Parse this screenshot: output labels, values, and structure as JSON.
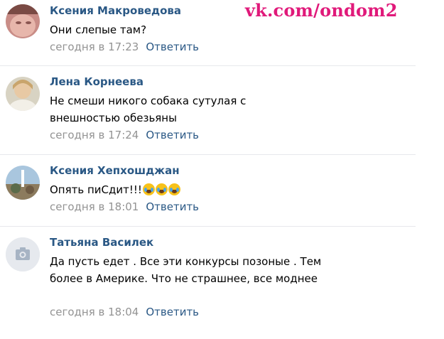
{
  "watermark": "vk.com/ondom2",
  "reply_label": "Ответить",
  "comments": [
    {
      "author": "Ксения Макроведова",
      "text": "Они слепые там?",
      "date": "сегодня в 17:23"
    },
    {
      "author": "Лена Корнеева",
      "text": "Не смеши никого собака сутулая с внешностью обезьяны",
      "date": "сегодня в 17:24"
    },
    {
      "author": "Ксения Хепхошджан",
      "text": "Опять пиСдит!!!",
      "date": "сегодня в 18:01",
      "emoji": "tears-of-joy-emoji"
    },
    {
      "author": "Татьяна Василек",
      "text": "Да пусть едет . Все эти конкурсы позоные . Тем более в Америке. Что не страшнее, все моднее",
      "date": "сегодня в 18:04"
    }
  ],
  "colors": {
    "author": "#2a5885",
    "date": "#939393",
    "text": "#000000",
    "divider": "#e7e8ec",
    "watermark": "#e0197a"
  }
}
